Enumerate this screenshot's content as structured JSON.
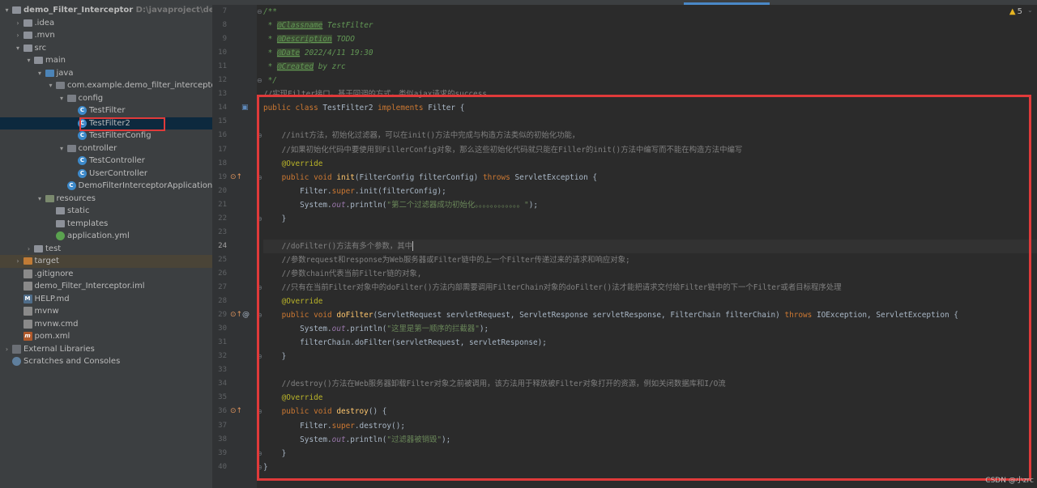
{
  "tree": {
    "rows": [
      {
        "label": "demo_Filter_Interceptor",
        "hint": "D:\\javaproject\\demo_Filt",
        "indent": 0,
        "arrow": "▾",
        "icon": "folder",
        "icon_name": "project-folder-icon",
        "bold": true
      },
      {
        "label": ".idea",
        "indent": 1,
        "arrow": "›",
        "icon": "folder",
        "icon_name": "folder-icon"
      },
      {
        "label": ".mvn",
        "indent": 1,
        "arrow": "›",
        "icon": "folder",
        "icon_name": "folder-icon"
      },
      {
        "label": "src",
        "indent": 1,
        "arrow": "▾",
        "icon": "folder",
        "icon_name": "folder-icon"
      },
      {
        "label": "main",
        "indent": 2,
        "arrow": "▾",
        "icon": "folder",
        "icon_name": "folder-icon"
      },
      {
        "label": "java",
        "indent": 3,
        "arrow": "▾",
        "icon": "folder-src",
        "icon_name": "source-folder-icon"
      },
      {
        "label": "com.example.demo_filter_interceptor",
        "indent": 4,
        "arrow": "▾",
        "icon": "pkg",
        "icon_name": "package-icon"
      },
      {
        "label": "config",
        "indent": 5,
        "arrow": "▾",
        "icon": "pkg",
        "icon_name": "package-icon"
      },
      {
        "label": "TestFilter",
        "indent": 6,
        "arrow": "",
        "icon": "cls",
        "icon_name": "class-icon",
        "glyph": "C"
      },
      {
        "label": "TestFilter2",
        "indent": 6,
        "arrow": "",
        "icon": "cls",
        "icon_name": "class-icon",
        "glyph": "C",
        "selected": true
      },
      {
        "label": "TestFilterConfig",
        "indent": 6,
        "arrow": "",
        "icon": "cls",
        "icon_name": "class-icon",
        "glyph": "C"
      },
      {
        "label": "controller",
        "indent": 5,
        "arrow": "▾",
        "icon": "pkg",
        "icon_name": "package-icon"
      },
      {
        "label": "TestController",
        "indent": 6,
        "arrow": "",
        "icon": "cls",
        "icon_name": "class-icon",
        "glyph": "C"
      },
      {
        "label": "UserController",
        "indent": 6,
        "arrow": "",
        "icon": "cls",
        "icon_name": "class-icon",
        "glyph": "C"
      },
      {
        "label": "DemoFilterInterceptorApplication",
        "indent": 5,
        "arrow": "",
        "icon": "cls",
        "icon_name": "class-icon",
        "glyph": "C"
      },
      {
        "label": "resources",
        "indent": 3,
        "arrow": "▾",
        "icon": "folder-res",
        "icon_name": "resources-folder-icon"
      },
      {
        "label": "static",
        "indent": 4,
        "arrow": "",
        "icon": "folder",
        "icon_name": "folder-icon"
      },
      {
        "label": "templates",
        "indent": 4,
        "arrow": "",
        "icon": "folder",
        "icon_name": "folder-icon"
      },
      {
        "label": "application.yml",
        "indent": 4,
        "arrow": "",
        "icon": "spring",
        "icon_name": "yaml-spring-icon"
      },
      {
        "label": "test",
        "indent": 2,
        "arrow": "›",
        "icon": "folder",
        "icon_name": "folder-icon"
      },
      {
        "label": "target",
        "indent": 1,
        "arrow": "›",
        "icon": "folder-orange",
        "icon_name": "excluded-folder-icon",
        "excluded": true
      },
      {
        "label": ".gitignore",
        "indent": 1,
        "arrow": "",
        "icon": "file",
        "icon_name": "file-icon"
      },
      {
        "label": "demo_Filter_Interceptor.iml",
        "indent": 1,
        "arrow": "",
        "icon": "file",
        "icon_name": "module-file-icon"
      },
      {
        "label": "HELP.md",
        "indent": 1,
        "arrow": "",
        "icon": "md",
        "icon_name": "markdown-icon",
        "glyph": "M"
      },
      {
        "label": "mvnw",
        "indent": 1,
        "arrow": "",
        "icon": "file",
        "icon_name": "shell-file-icon"
      },
      {
        "label": "mvnw.cmd",
        "indent": 1,
        "arrow": "",
        "icon": "file",
        "icon_name": "cmd-file-icon"
      },
      {
        "label": "pom.xml",
        "indent": 1,
        "arrow": "",
        "icon": "mvn",
        "icon_name": "maven-icon",
        "glyph": "m"
      },
      {
        "label": "External Libraries",
        "indent": 0,
        "arrow": "›",
        "icon": "lib",
        "icon_name": "library-icon"
      },
      {
        "label": "Scratches and Consoles",
        "indent": 0,
        "arrow": "",
        "icon": "scr",
        "icon_name": "scratches-icon"
      }
    ]
  },
  "editor": {
    "warnings": "5",
    "current_line": 24,
    "lines": [
      {
        "n": 7,
        "fold": "⊖",
        "t": [
          [
            "dc",
            "/**"
          ]
        ]
      },
      {
        "n": 8,
        "t": [
          [
            "dc",
            " * "
          ],
          [
            "dt",
            "@Classname"
          ],
          [
            "dc",
            " TestFilter"
          ]
        ]
      },
      {
        "n": 9,
        "t": [
          [
            "dc",
            " * "
          ],
          [
            "dt",
            "@Description"
          ],
          [
            "dc",
            " TODO"
          ]
        ]
      },
      {
        "n": 10,
        "t": [
          [
            "dc",
            " * "
          ],
          [
            "dt",
            "@Date"
          ],
          [
            "dc",
            " 2022/4/11 19:30"
          ]
        ]
      },
      {
        "n": 11,
        "t": [
          [
            "dc",
            " * "
          ],
          [
            "dt",
            "@Created"
          ],
          [
            "dc",
            " by zrc"
          ]
        ]
      },
      {
        "n": 12,
        "fold": "⊖",
        "t": [
          [
            "dc",
            " */"
          ]
        ]
      },
      {
        "n": 13,
        "t": [
          [
            "cm",
            "//实现Filter接口，基于回调的方式，类似ajax请求的success."
          ]
        ]
      },
      {
        "n": 14,
        "mark": "class",
        "t": [
          [
            "k",
            "public class "
          ],
          [
            "",
            "TestFilter2 "
          ],
          [
            "k",
            "implements "
          ],
          [
            "",
            "Filter {"
          ]
        ]
      },
      {
        "n": 15,
        "t": []
      },
      {
        "n": 16,
        "fold": "⊖",
        "t": [
          [
            "cm",
            "    //init方法，初始化过滤器，可以在init()方法中完成与构造方法类似的初始化功能，"
          ]
        ]
      },
      {
        "n": 17,
        "t": [
          [
            "cm",
            "    //如果初始化代码中要使用到FillerConfig对象，那么这些初始化代码就只能在Filler的init()方法中编写而不能在构造方法中编写"
          ]
        ]
      },
      {
        "n": 18,
        "t": [
          [
            "an",
            "    @Override"
          ]
        ]
      },
      {
        "n": 19,
        "mark": "override",
        "fold": "⊖",
        "t": [
          [
            "k",
            "    public void "
          ],
          [
            "fn",
            "init"
          ],
          [
            "",
            "(FilterConfig filterConfig) "
          ],
          [
            "k",
            "throws "
          ],
          [
            "",
            "ServletException {"
          ]
        ]
      },
      {
        "n": 20,
        "t": [
          [
            "",
            "        Filter."
          ],
          [
            "k",
            "super"
          ],
          [
            "",
            ".init(filterConfig);"
          ]
        ]
      },
      {
        "n": 21,
        "t": [
          [
            "",
            "        System."
          ],
          [
            "fi",
            "out"
          ],
          [
            "",
            ".println("
          ],
          [
            "st",
            "\"第二个过滤器成功初始化。。。。。。。。。。。。\""
          ],
          [
            "",
            ");"
          ]
        ]
      },
      {
        "n": 22,
        "fold": "⊖",
        "t": [
          [
            "",
            "    }"
          ]
        ]
      },
      {
        "n": 23,
        "t": []
      },
      {
        "n": 24,
        "t": [
          [
            "cm",
            "    //doFilter()方法有多个参数，其中"
          ]
        ],
        "caret": true
      },
      {
        "n": 25,
        "t": [
          [
            "cm",
            "    //参数request和response为Web服务器或Filter链中的上一个Filter传递过来的请求和响应对象;"
          ]
        ]
      },
      {
        "n": 26,
        "t": [
          [
            "cm",
            "    //参数chain代表当前Filter链的对象,"
          ]
        ]
      },
      {
        "n": 27,
        "fold": "⊖",
        "t": [
          [
            "cm",
            "    //只有在当前Filter对象中的doFilter()方法内部需要调用FilterChain对象的doFilter()法才能把请求交付给Filter链中的下一个Filter或者目标程序处理"
          ]
        ]
      },
      {
        "n": 28,
        "t": [
          [
            "an",
            "    @Override"
          ]
        ]
      },
      {
        "n": 29,
        "mark": "override-at",
        "fold": "⊖",
        "t": [
          [
            "k",
            "    public void "
          ],
          [
            "fn",
            "doFilter"
          ],
          [
            "",
            "(ServletRequest servletRequest, ServletResponse servletResponse, FilterChain filterChain) "
          ],
          [
            "k",
            "throws "
          ],
          [
            "",
            "IOException, ServletException {"
          ]
        ]
      },
      {
        "n": 30,
        "t": [
          [
            "",
            "        System."
          ],
          [
            "fi",
            "out"
          ],
          [
            "",
            ".println("
          ],
          [
            "st",
            "\"这里是第一顺序的拦截器\""
          ],
          [
            "",
            ");"
          ]
        ]
      },
      {
        "n": 31,
        "t": [
          [
            "",
            "        filterChain.doFilter(servletRequest, servletResponse);"
          ]
        ]
      },
      {
        "n": 32,
        "fold": "⊖",
        "t": [
          [
            "",
            "    }"
          ]
        ]
      },
      {
        "n": 33,
        "t": []
      },
      {
        "n": 34,
        "t": [
          [
            "cm",
            "    //destroy()方法在Web服务器卸载Filter对象之前被调用，该方法用于释放被Filter对象打开的资源，例如关闭数据库和I/O流"
          ]
        ]
      },
      {
        "n": 35,
        "t": [
          [
            "an",
            "    @Override"
          ]
        ]
      },
      {
        "n": 36,
        "mark": "override",
        "fold": "⊖",
        "t": [
          [
            "k",
            "    public void "
          ],
          [
            "fn",
            "destroy"
          ],
          [
            "",
            "() {"
          ]
        ]
      },
      {
        "n": 37,
        "t": [
          [
            "",
            "        Filter."
          ],
          [
            "k",
            "super"
          ],
          [
            "",
            ".destroy();"
          ]
        ]
      },
      {
        "n": 38,
        "t": [
          [
            "",
            "        System."
          ],
          [
            "fi",
            "out"
          ],
          [
            "",
            ".println("
          ],
          [
            "st",
            "\"过滤器被销毁\""
          ],
          [
            "",
            ");"
          ]
        ]
      },
      {
        "n": 39,
        "fold": "⊖",
        "t": [
          [
            "",
            "    }"
          ]
        ]
      },
      {
        "n": 40,
        "fold": "⊖",
        "t": [
          [
            "",
            "}"
          ]
        ]
      }
    ]
  },
  "watermark": "CSDN @小zrc"
}
